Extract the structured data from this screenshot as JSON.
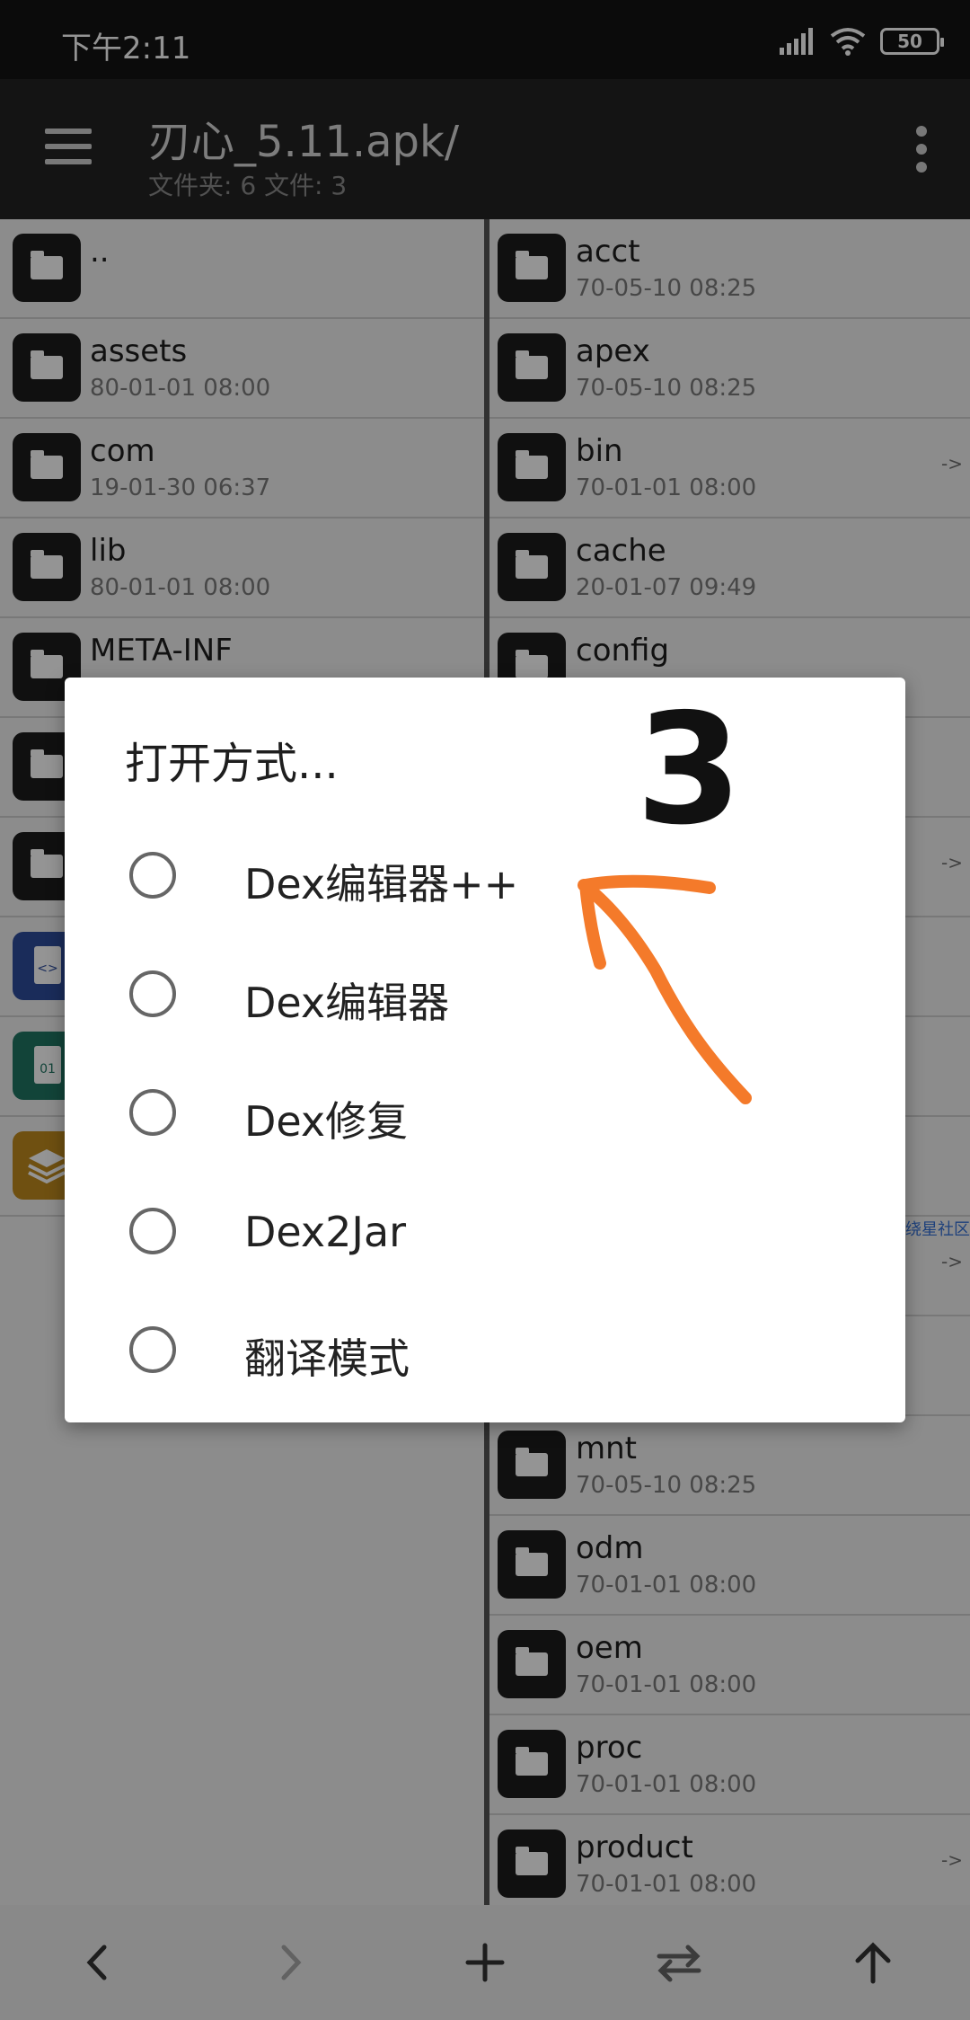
{
  "status_bar": {
    "time": "下午2:11",
    "battery": "50"
  },
  "app_bar": {
    "title": "刃心_5.11.apk/",
    "subtitle": "文件夹: 6  文件: 3"
  },
  "left_pane": {
    "items": [
      {
        "name": "..",
        "date": "",
        "icon": "folder-icon"
      },
      {
        "name": "assets",
        "date": "80-01-01 08:00",
        "icon": "folder-icon"
      },
      {
        "name": "com",
        "date": "19-01-30 06:37",
        "icon": "folder-icon"
      },
      {
        "name": "lib",
        "date": "80-01-01 08:00",
        "icon": "folder-icon"
      },
      {
        "name": "META-INF",
        "date": "",
        "icon": "folder-icon"
      },
      {
        "name": "",
        "date": "",
        "icon": "folder-icon"
      },
      {
        "name": "",
        "date": "",
        "icon": "folder-icon"
      },
      {
        "name": "",
        "date": "",
        "icon": "code-file-icon"
      },
      {
        "name": "",
        "date": "",
        "icon": "binary-file-icon"
      },
      {
        "name": "",
        "date": "",
        "icon": "layers-file-icon"
      }
    ]
  },
  "right_pane": {
    "items": [
      {
        "name": "acct",
        "date": "70-05-10 08:25",
        "link": ""
      },
      {
        "name": "apex",
        "date": "70-05-10 08:25",
        "link": ""
      },
      {
        "name": "bin",
        "date": "70-01-01 08:00",
        "link": "->"
      },
      {
        "name": "cache",
        "date": "20-01-07 09:49",
        "link": ""
      },
      {
        "name": "config",
        "date": "",
        "link": ""
      },
      {
        "name": "",
        "date": "",
        "link": ""
      },
      {
        "name": "",
        "date": "",
        "link": "->"
      },
      {
        "name": "",
        "date": "",
        "link": ""
      },
      {
        "name": "",
        "date": "",
        "link": ""
      },
      {
        "name": "",
        "date": "",
        "link": ""
      },
      {
        "name": "",
        "date": "",
        "link": "->"
      },
      {
        "name": "",
        "date": "",
        "link": ""
      },
      {
        "name": "mnt",
        "date": "70-05-10 08:25",
        "link": ""
      },
      {
        "name": "odm",
        "date": "70-01-01 08:00",
        "link": ""
      },
      {
        "name": "oem",
        "date": "70-01-01 08:00",
        "link": ""
      },
      {
        "name": "proc",
        "date": "70-01-01 08:00",
        "link": ""
      },
      {
        "name": "product",
        "date": "70-01-01 08:00",
        "link": "->"
      }
    ],
    "side_tag": "绕星社区"
  },
  "dialog": {
    "title": "打开方式...",
    "options": [
      "Dex编辑器++",
      "Dex编辑器",
      "Dex修复",
      "Dex2Jar",
      "翻译模式"
    ]
  },
  "annotation": {
    "text": "3",
    "color": "#f47a2a"
  },
  "toolbar": {
    "buttons": [
      "back-icon",
      "forward-icon",
      "add-icon",
      "swap-icon",
      "up-icon"
    ]
  }
}
